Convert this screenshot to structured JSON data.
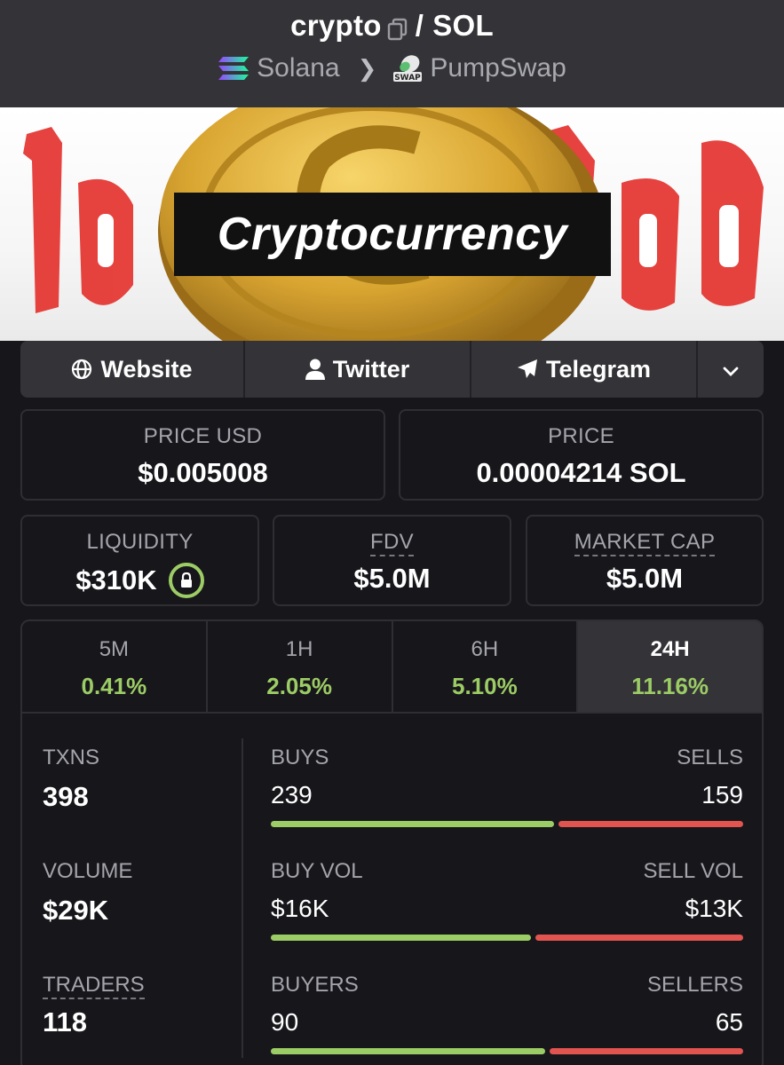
{
  "header": {
    "token": "crypto",
    "separator": "/",
    "quote": "SOL",
    "chain": "Solana",
    "dex": "PumpSwap",
    "dex_badge": "SWAP"
  },
  "banner": {
    "label": "Cryptocurrency"
  },
  "links": {
    "website": "Website",
    "twitter": "Twitter",
    "telegram": "Telegram"
  },
  "price": {
    "usd_label": "PRICE USD",
    "usd_value": "$0.005008",
    "native_label": "PRICE",
    "native_value": "0.00004214 SOL"
  },
  "metrics": {
    "liquidity_label": "LIQUIDITY",
    "liquidity_value": "$310K",
    "fdv_label": "FDV",
    "fdv_value": "$5.0M",
    "mcap_label": "MARKET CAP",
    "mcap_value": "$5.0M"
  },
  "timeframes": [
    {
      "label": "5M",
      "change": "0.41%"
    },
    {
      "label": "1H",
      "change": "2.05%"
    },
    {
      "label": "6H",
      "change": "5.10%"
    },
    {
      "label": "24H",
      "change": "11.16%"
    }
  ],
  "active_timeframe": "24H",
  "stats": {
    "txns_label": "TXNS",
    "txns_value": "398",
    "volume_label": "VOLUME",
    "volume_value": "$29K",
    "traders_label": "TRADERS",
    "traders_value": "118",
    "buys_label": "BUYS",
    "buys_value": "239",
    "sells_label": "SELLS",
    "sells_value": "159",
    "buyvol_label": "BUY VOL",
    "buyvol_value": "$16K",
    "sellvol_label": "SELL VOL",
    "sellvol_value": "$13K",
    "buyers_label": "BUYERS",
    "buyers_value": "90",
    "sellers_label": "SELLERS",
    "sellers_value": "65",
    "buys_share": 0.6,
    "buyvol_share": 0.55,
    "buyers_share": 0.58
  },
  "colors": {
    "positive": "#9ccc65",
    "negative": "#e2544f",
    "panel": "#343438",
    "background": "#17161b"
  }
}
